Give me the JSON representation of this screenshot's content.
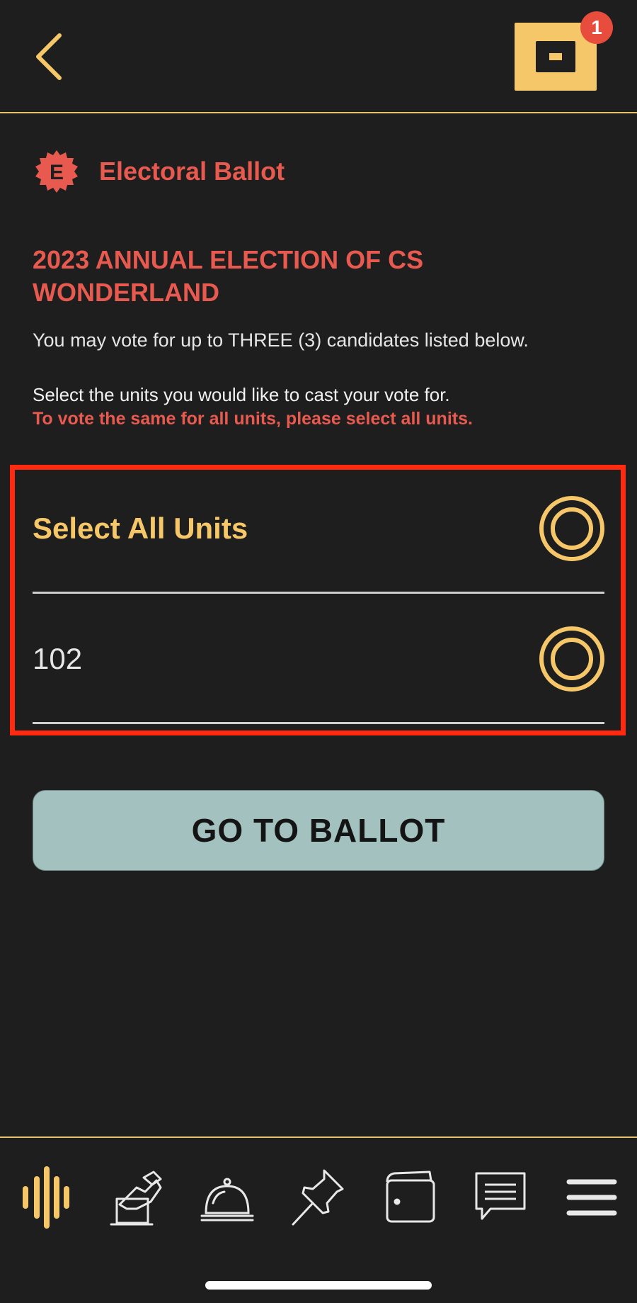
{
  "header": {
    "notification_count": "1",
    "back_icon": "chevron-left-icon",
    "ballot_box_icon": "ballot-slot-icon"
  },
  "section": {
    "seal_letter": "E",
    "title": "Electoral Ballot"
  },
  "election": {
    "title": "2023 ANNUAL ELECTION OF CS WONDERLAND",
    "intro": "You may vote for up to THREE (3) candidates listed below.",
    "select_prompt": "Select the units you would like to cast your vote for.",
    "select_note": "To vote the same for all units,  please select all units."
  },
  "units": [
    {
      "label": "Select All Units",
      "selected": false
    },
    {
      "label": "102",
      "selected": false
    }
  ],
  "actions": {
    "go_to_ballot": "GO TO BALLOT"
  },
  "bottom_nav": [
    {
      "icon": "audio-wave-icon",
      "active": true
    },
    {
      "icon": "hand-voting-icon",
      "active": false
    },
    {
      "icon": "service-bell-icon",
      "active": false
    },
    {
      "icon": "pushpin-icon",
      "active": false
    },
    {
      "icon": "wallet-icon",
      "active": false
    },
    {
      "icon": "chat-icon",
      "active": false
    },
    {
      "icon": "menu-icon",
      "active": false
    }
  ],
  "colors": {
    "background": "#1e1e1e",
    "accent_gold": "#f6c768",
    "accent_red": "#e85a4f",
    "highlight_red": "#ff2a10",
    "button_bg": "#a3c2bf"
  }
}
